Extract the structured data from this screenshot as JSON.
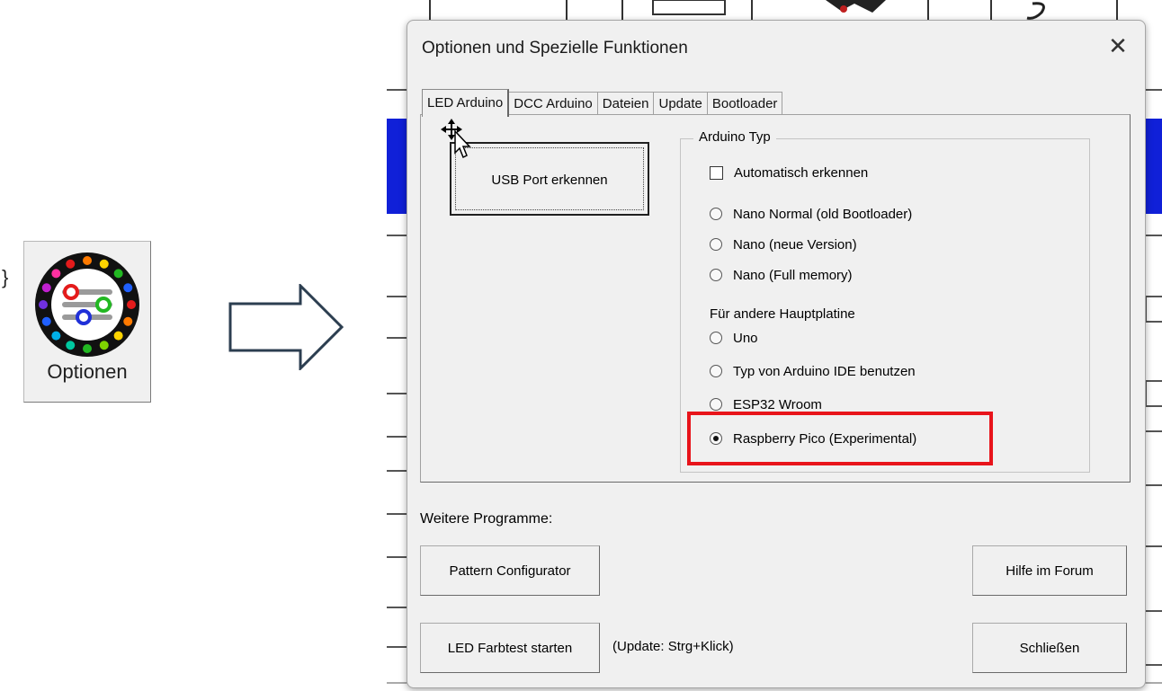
{
  "left_button": {
    "bracket_glyph": "}",
    "label": "Optionen",
    "icon": "options-sliders-color-wheel-icon"
  },
  "arrow_icon": "right-arrow-outline-icon",
  "dialog": {
    "title": "Optionen und Spezielle Funktionen",
    "close_glyph": "✕",
    "tabs": [
      {
        "label": "LED Arduino",
        "active": true
      },
      {
        "label": "DCC Arduino",
        "active": false
      },
      {
        "label": "Dateien",
        "active": false
      },
      {
        "label": "Update",
        "active": false
      },
      {
        "label": "Bootloader",
        "active": false
      }
    ],
    "usb_button": "USB Port erkennen",
    "group": {
      "legend": "Arduino Typ",
      "auto_detect": {
        "label": "Automatisch erkennen",
        "checked": false
      },
      "radios_a": [
        {
          "label": "Nano Normal (old Bootloader)",
          "checked": false
        },
        {
          "label": "Nano (neue Version)",
          "checked": false
        },
        {
          "label": "Nano (Full memory)",
          "checked": false
        }
      ],
      "subheading": "Für andere Hauptplatine",
      "radios_b": [
        {
          "label": "Uno",
          "checked": false
        },
        {
          "label": "Typ von Arduino IDE benutzen",
          "checked": false
        },
        {
          "label": "ESP32 Wroom",
          "checked": false
        },
        {
          "label": "Raspberry Pico (Experimental)",
          "checked": true
        }
      ]
    },
    "weitere_label": "Weitere Programme:",
    "pattern_button": "Pattern Configurator",
    "hilfe_button": "Hilfe im Forum",
    "farbtest_button": "LED Farbtest starten",
    "update_hint": "(Update: Strg+Klick)",
    "schliessen_button": "Schließen"
  },
  "colors": {
    "highlight": "#e8141b",
    "dialog_bg": "#f0f0f0",
    "sheet_blue": "#1020d8",
    "sheet_text_yellow": "#ffff00"
  }
}
